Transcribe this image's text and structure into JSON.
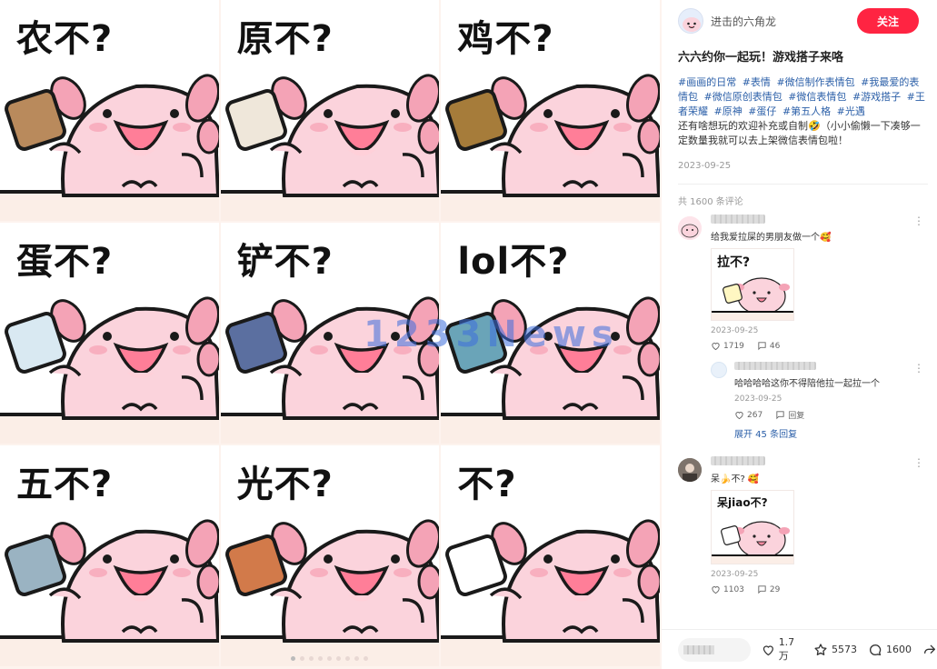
{
  "media": {
    "captions": [
      "农不?",
      "原不?",
      "鸡不?",
      "蛋不?",
      "铲不?",
      "lol不?",
      "五不?",
      "光不?",
      "不?"
    ],
    "watermark": "1233News",
    "slide_count": 9,
    "active_slide": 1
  },
  "author": {
    "name": "进击的六角龙",
    "follow_label": "关注"
  },
  "note": {
    "title": "六六约你一起玩！游戏搭子来咯",
    "tags": [
      "#画画的日常",
      "#表情",
      "#微信制作表情包",
      "#我最爱的表情包",
      "#微信原创表情包",
      "#微信表情包",
      "#游戏搭子",
      "#王者荣耀",
      "#原神",
      "#蛋仔",
      "#第五人格",
      "#光遇"
    ],
    "body": "还有啥想玩的欢迎补充或自制🤣（小小偷懒一下凑够一定数量我就可以去上架微信表情包啦！",
    "date": "2023-09-25"
  },
  "comments_header": "共 1600 条评论",
  "comments": [
    {
      "text": "给我爱拉屎的男朋友做一个🥰",
      "sticker_caption": "拉不?",
      "date": "2023-09-25",
      "likes": "1719",
      "replies_count": "46",
      "reply": {
        "text": "哈哈哈哈这你不得陪他拉一起拉一个",
        "date": "2023-09-25",
        "likes": "267",
        "reply_label": "回复"
      },
      "expand_label": "展开 45 条回复"
    },
    {
      "text": "呆🍌不? 🥰",
      "sticker_caption": "呆jiao不?",
      "date": "2023-09-25",
      "likes": "1103",
      "replies_count": "29"
    }
  ],
  "bottom_bar": {
    "likes": "1.7万",
    "stars": "5573",
    "comments": "1600"
  },
  "colors": {
    "accent": "#ff2442",
    "tag": "#2b5fa8",
    "axolotl_body": "#fbd3dc",
    "axolotl_gill": "#f4a3b6"
  }
}
